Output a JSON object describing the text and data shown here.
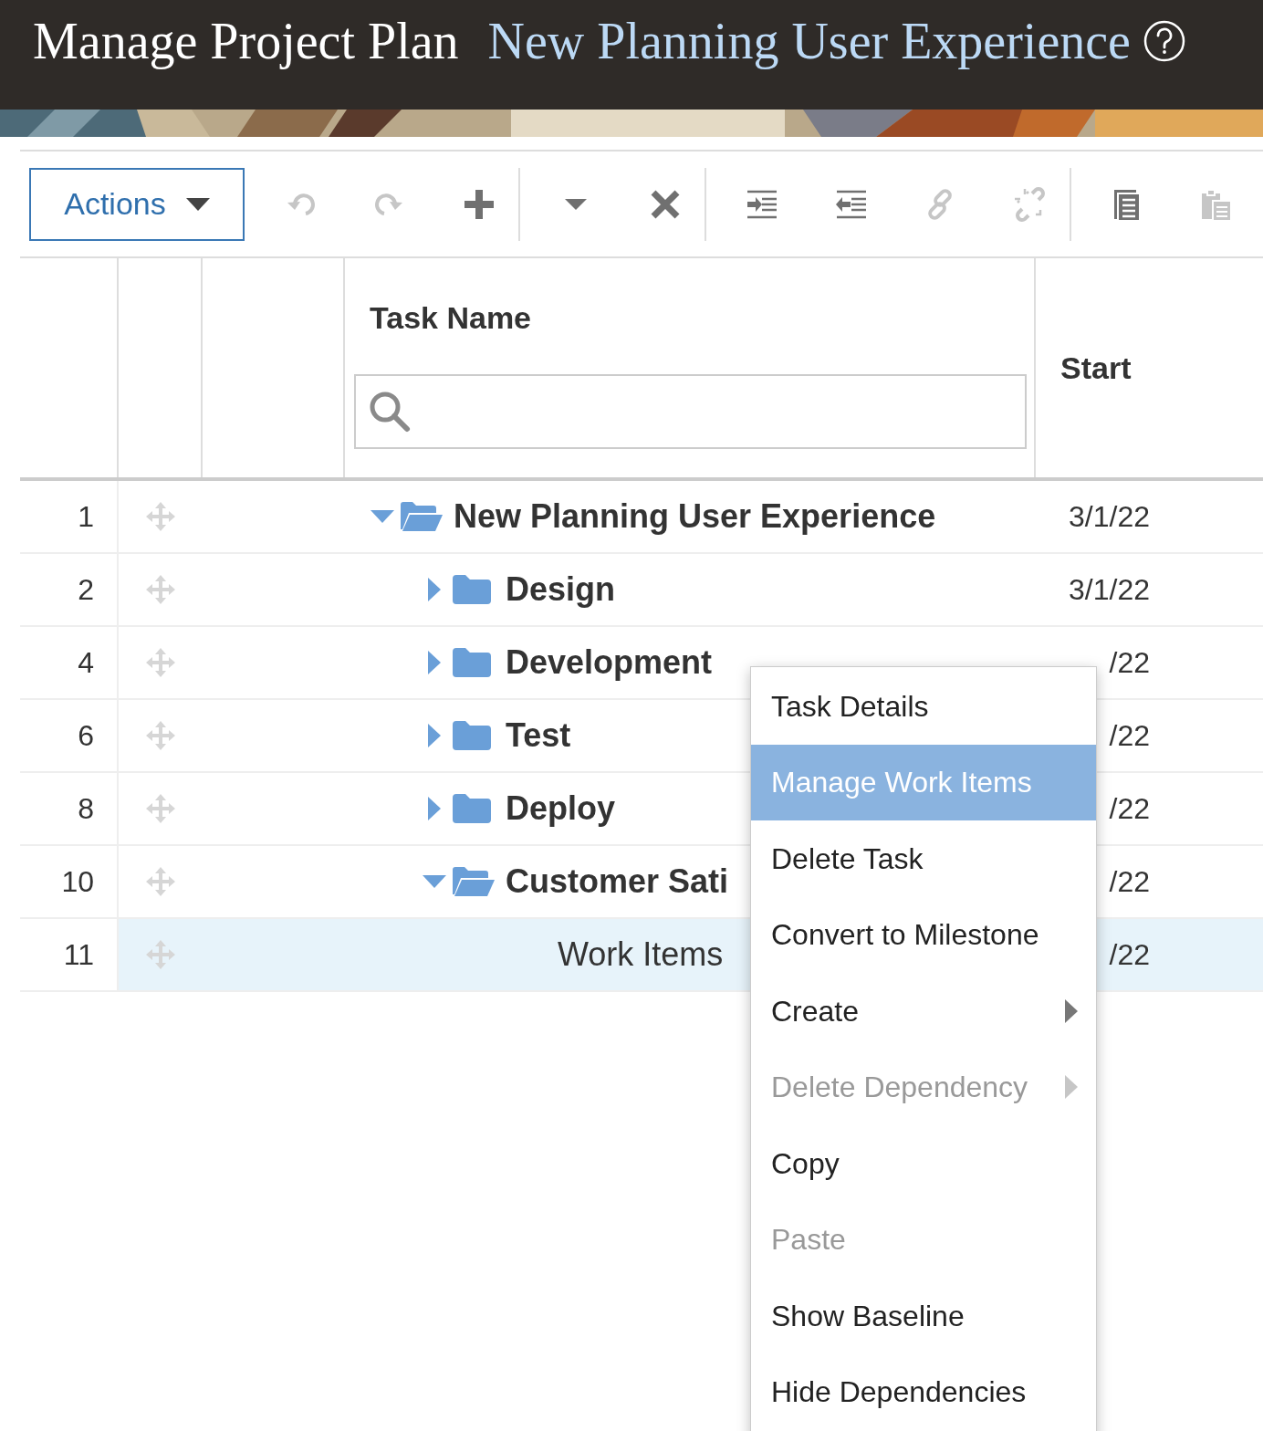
{
  "header": {
    "title": "Manage Project Plan",
    "project_link": "New Planning User Experience"
  },
  "toolbar": {
    "actions_button": "Actions",
    "tool_groups": [
      [
        {
          "kind": "undo",
          "disabled": true
        },
        {
          "kind": "redo",
          "disabled": true
        },
        {
          "kind": "add",
          "disabled": false
        }
      ],
      [
        {
          "kind": "dropdown",
          "disabled": false
        },
        {
          "kind": "delete",
          "disabled": false
        }
      ],
      [
        {
          "kind": "indent",
          "disabled": false
        },
        {
          "kind": "outdent",
          "disabled": false
        },
        {
          "kind": "link",
          "disabled": true
        },
        {
          "kind": "unlink",
          "disabled": true
        }
      ],
      [
        {
          "kind": "details",
          "disabled": false
        },
        {
          "kind": "paste",
          "disabled": true
        }
      ]
    ]
  },
  "table": {
    "columns": {
      "task_name": "Task Name",
      "start": "Start"
    },
    "rows": [
      {
        "number": "1",
        "kind": "summary",
        "name": "New Planning User Experience",
        "start": "3/1/22",
        "expanded": true,
        "selected": false,
        "children": [
          {
            "number": "2",
            "kind": "summary",
            "name": "Design",
            "start": "3/1/22",
            "expanded": false,
            "selected": false
          },
          {
            "number": "4",
            "kind": "summary",
            "name": "Development",
            "start": "/22",
            "expanded": false,
            "selected": false
          },
          {
            "number": "6",
            "kind": "summary",
            "name": "Test",
            "start": "/22",
            "expanded": false,
            "selected": false
          },
          {
            "number": "8",
            "kind": "summary",
            "name": "Deploy",
            "start": "/22",
            "expanded": false,
            "selected": false
          },
          {
            "number": "10",
            "kind": "summary",
            "name": "Customer Sati",
            "start": "/22",
            "expanded": true,
            "selected": false,
            "children": [
              {
                "number": "11",
                "kind": "task",
                "name": "Work Items",
                "start": "/22",
                "selected": true
              }
            ]
          }
        ]
      }
    ]
  },
  "context_menu": {
    "items": [
      {
        "label": "Task Details",
        "selected": false,
        "disabled": false,
        "submenu": false
      },
      {
        "label": "Manage Work Items",
        "selected": true,
        "disabled": false,
        "submenu": false
      },
      {
        "label": "Delete Task",
        "selected": false,
        "disabled": false,
        "submenu": false
      },
      {
        "label": "Convert to Milestone",
        "selected": false,
        "disabled": false,
        "submenu": false
      },
      {
        "label": "Create",
        "selected": false,
        "disabled": false,
        "submenu": true
      },
      {
        "label": "Delete Dependency",
        "selected": false,
        "disabled": true,
        "submenu": true
      },
      {
        "label": "Copy",
        "selected": false,
        "disabled": false,
        "submenu": false
      },
      {
        "label": "Paste",
        "selected": false,
        "disabled": true,
        "submenu": false
      },
      {
        "label": "Show Baseline",
        "selected": false,
        "disabled": false,
        "submenu": false
      },
      {
        "label": "Hide Dependencies",
        "selected": false,
        "disabled": false,
        "submenu": false
      }
    ]
  }
}
